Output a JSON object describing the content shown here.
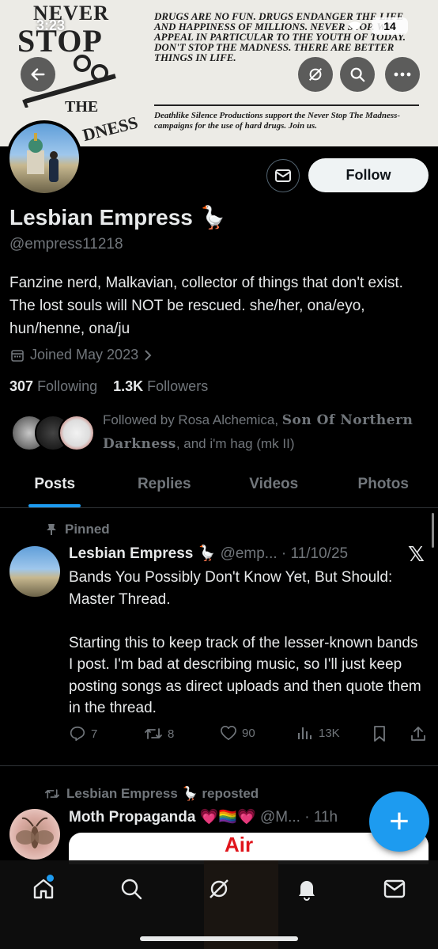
{
  "status_bar": {
    "time": "3:23",
    "battery": "14"
  },
  "banner": {
    "logo_never": "NEVER",
    "logo_stop": "STOP",
    "logo_the": "THE",
    "logo_madness": "DNESS",
    "text": "DRUGS ARE NO FUN. DRUGS ENDANGER THE LIFE AND HAPPINESS OF MILLIONS. NEVER STOP. WE APPEAL IN PARTICULAR TO THE YOUTH OF TODAY. DON'T STOP THE MADNESS. THERE ARE BETTER THINGS IN LIFE.",
    "footer": "Deathlike Silence Productions support the Never Stop The Madness- campaigns for the use of hard drugs. Join us."
  },
  "profile": {
    "name": "Lesbian Empress 🪿",
    "handle": "@empress11218",
    "bio": "Fanzine nerd, Malkavian, collector of things that don't exist. The lost souls will NOT be rescued. she/her, ona/eyo, hun/henne, ona/ju",
    "joined": "Joined May 2023",
    "following_count": "307",
    "following_label": "Following",
    "followers_count": "1.3K",
    "followers_label": "Followers",
    "follow_button": "Follow",
    "followed_by_prefix": "Followed by Rosa Alchemica, ",
    "followed_by_goth": "Son Of Northern Darkness",
    "followed_by_suffix": ", and i'm hag (mk II)"
  },
  "tabs": [
    "Posts",
    "Replies",
    "Videos",
    "Photos"
  ],
  "pinned_tweet": {
    "pinned_label": "Pinned",
    "author": "Lesbian Empress 🪿",
    "handle_date": "@emp... · 11/10/25",
    "body": "Bands You Possibly Don't Know Yet, But Should: Master Thread.\n\nStarting this to keep track of the lesser-known bands I post. I'm bad at describing music, so I'll just keep posting songs as direct uploads and then quote them in the thread.",
    "replies": "7",
    "reposts": "8",
    "likes": "90",
    "views": "13K"
  },
  "repost": {
    "label": "Lesbian Empress 🪿 reposted",
    "author": "Moth Propaganda 💗🏳️‍🌈💗",
    "handle_date": "@M... · 11h",
    "media_text": "Air"
  },
  "fab_label": "+",
  "colors": {
    "accent": "#1d9bf0",
    "background": "#000000",
    "muted": "#71767b",
    "text": "#e7e9ea"
  }
}
